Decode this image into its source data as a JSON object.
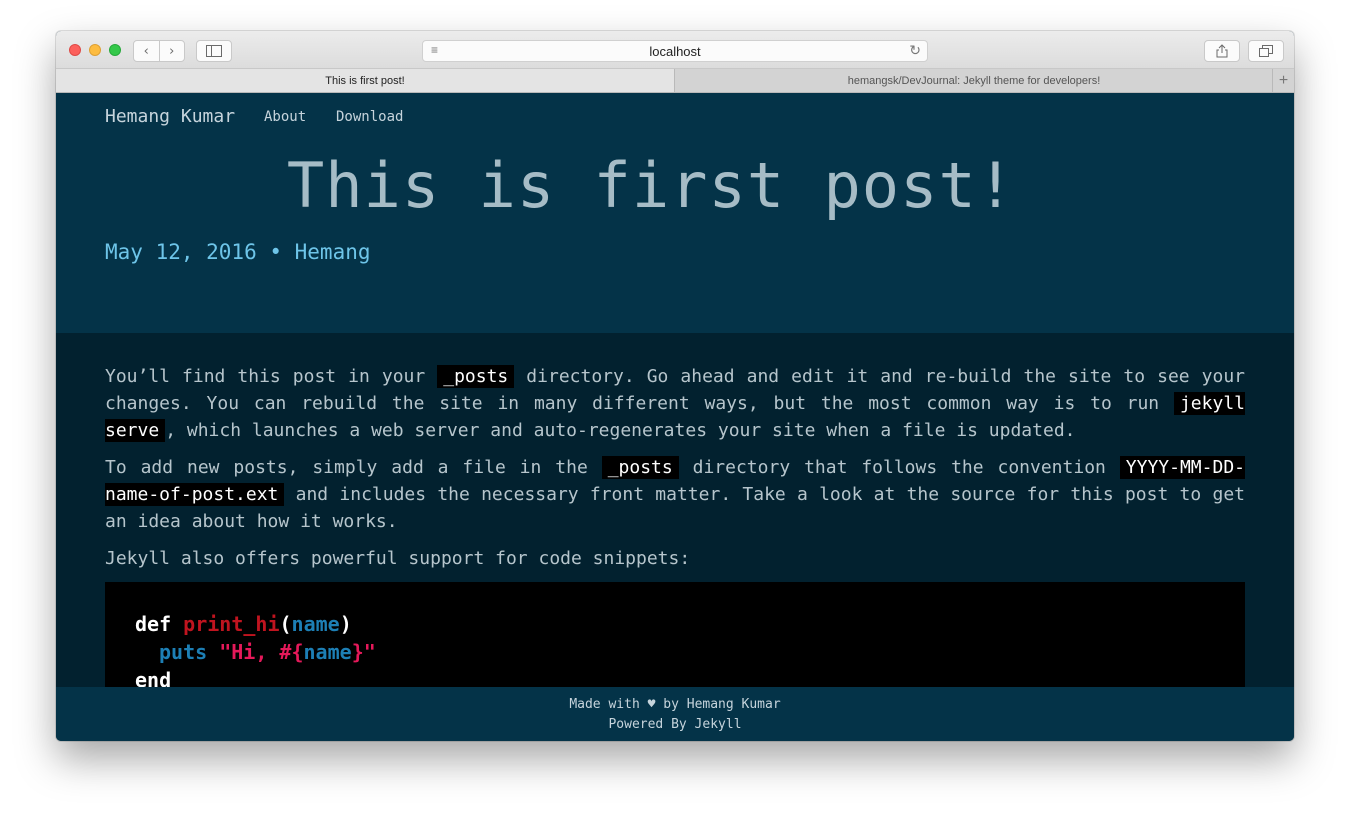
{
  "browser": {
    "url": "localhost",
    "tabs": [
      {
        "label": "This is first post!"
      },
      {
        "label": "hemangsk/DevJournal: Jekyll theme for developers!"
      }
    ],
    "icons": {
      "back": "‹",
      "forward": "›",
      "reload": "↻",
      "reader": "≡",
      "add_tab": "+"
    }
  },
  "site": {
    "title": "Hemang Kumar",
    "nav": [
      {
        "label": "About"
      },
      {
        "label": "Download"
      }
    ]
  },
  "post": {
    "title": "This is first post!",
    "meta": "May 12, 2016 • Hemang",
    "p1_a": "You’ll find this post in your ",
    "p1_code1": "_posts",
    "p1_b": " directory. Go ahead and edit it and re-build the site to see your changes. You can rebuild the site in many different ways, but the most common way is to run ",
    "p1_code2": "jekyll serve",
    "p1_c": ", which launches a web server and auto-regenerates your site when a file is updated.",
    "p2_a": "To add new posts, simply add a file in the ",
    "p2_code1": "_posts",
    "p2_b": " directory that follows the convention ",
    "p2_code2": "YYYY-MM-DD-name-of-post.ext",
    "p2_c": " and includes the necessary front matter. Take a look at the source for this post to get an idea about how it works.",
    "p3": "Jekyll also offers powerful support for code snippets:",
    "code": {
      "l1_kw": "def",
      "l1_fn": "print_hi",
      "l1_open": "(",
      "l1_arg": "name",
      "l1_close": ")",
      "l2_fn": "puts",
      "l2_str_a": "\"Hi, #{",
      "l2_arg": "name",
      "l2_str_b": "}\"",
      "l3_kw": "end"
    }
  },
  "footer": {
    "made_a": "Made with",
    "heart": "♥",
    "made_b": "by Hemang Kumar",
    "powered": "Powered By Jekyll"
  }
}
